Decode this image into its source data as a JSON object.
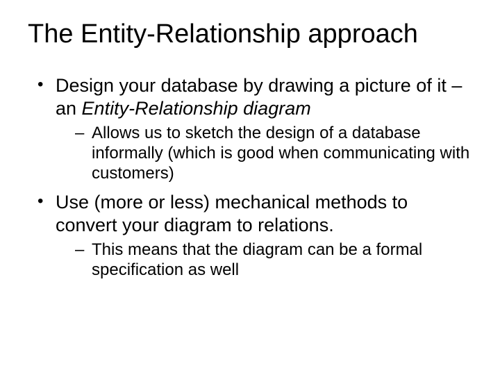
{
  "title": "The Entity-Relationship approach",
  "bullets": {
    "b1_pre": "Design your database by drawing a picture of it – an ",
    "b1_em": "Entity-Relationship diagram",
    "b1_sub1": "Allows us to sketch the design of a database informally (which is good when communicating with customers)",
    "b2": "Use (more or less) mechanical methods to convert your diagram to relations.",
    "b2_sub1": "This means that the diagram can be a formal specification as well"
  }
}
